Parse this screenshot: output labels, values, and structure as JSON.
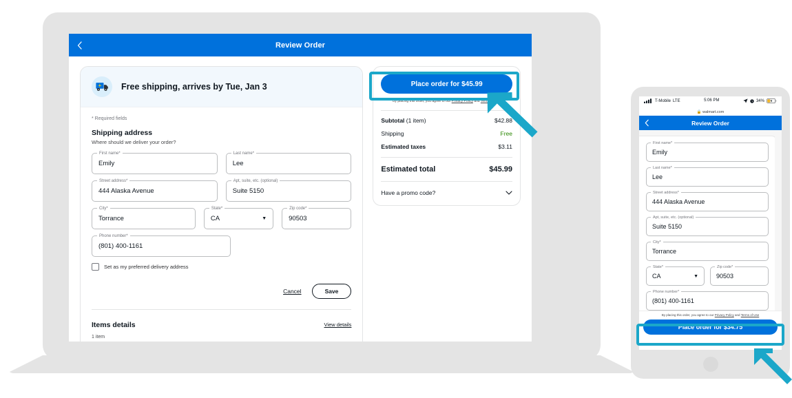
{
  "laptop": {
    "header": {
      "back_icon": "chevron-left-icon",
      "title": "Review Order"
    },
    "shipping_banner": {
      "icon": "delivery-truck-icon",
      "text": "Free shipping, arrives by Tue, Jan 3"
    },
    "required_note": "* Required fields",
    "section": {
      "title": "Shipping address",
      "subtitle": "Where should we deliver your order?"
    },
    "fields": [
      {
        "label": "First name*",
        "value": "Emily",
        "name": "first-name"
      },
      {
        "label": "Last name*",
        "value": "Lee",
        "name": "last-name"
      },
      {
        "label": "Street address*",
        "value": "444 Alaska Avenue",
        "name": "street-address"
      },
      {
        "label": "Apt, suite, etc. (optional)",
        "value": "Suite 5150",
        "name": "apt-suite"
      },
      {
        "label": "City*",
        "value": "Torrance",
        "name": "city"
      },
      {
        "label": "State*",
        "value": "CA",
        "name": "state"
      },
      {
        "label": "Zip code*",
        "value": "90503",
        "name": "zip-code"
      },
      {
        "label": "Phone number*",
        "value": "(801) 400-1161",
        "name": "phone-number"
      }
    ],
    "checkbox_label": "Set as my preferred delivery address",
    "cancel_label": "Cancel",
    "save_label": "Save",
    "items": {
      "title": "Items details",
      "view_details": "View details",
      "count": "1 item"
    },
    "summary": {
      "cta": "Place order for $45.99",
      "disclaimer_pre": "By placing this order, you agree to our ",
      "disclaimer_link1": "Privacy Policy",
      "disclaimer_mid": " and ",
      "disclaimer_link2": "Terms of Use",
      "rows": [
        {
          "label_bold": "Subtotal",
          "label_rest": " (1 item)",
          "value": "$42.88",
          "free": false
        },
        {
          "label_bold": "",
          "label_rest": "Shipping",
          "value": "Free",
          "free": true
        },
        {
          "label_bold": "Estimated taxes",
          "label_rest": "",
          "value": "$3.11",
          "free": false
        }
      ],
      "total_label": "Estimated total",
      "total_value": "$45.99",
      "promo_label": "Have a promo code?",
      "promo_icon": "chevron-down-icon"
    }
  },
  "phone": {
    "status": {
      "carrier": "T-Mobile",
      "network": "LTE",
      "time": "5:06 PM",
      "battery": "34%"
    },
    "url": "walmart.com",
    "header": {
      "back_icon": "chevron-left-icon",
      "title": "Review Order"
    },
    "fields": [
      {
        "label": "First name*",
        "value": "Emily",
        "name": "first-name"
      },
      {
        "label": "Last name*",
        "value": "Lee",
        "name": "last-name"
      },
      {
        "label": "Street address*",
        "value": "444 Alaska Avenue",
        "name": "street-address"
      },
      {
        "label": "Apt, suite, etc. (optional)",
        "value": "Suite 5150",
        "name": "apt-suite"
      },
      {
        "label": "City*",
        "value": "Torrance",
        "name": "city"
      },
      {
        "label": "State*",
        "value": "CA",
        "name": "state"
      },
      {
        "label": "Zip code*",
        "value": "90503",
        "name": "zip-code"
      },
      {
        "label": "Phone number*",
        "value": "(801) 400-1161",
        "name": "phone-number"
      }
    ],
    "disclaimer_pre": "By placing this order, you agree to our ",
    "disclaimer_link1": "Privacy Policy",
    "disclaimer_mid": " and ",
    "disclaimer_link2": "Terms of Use",
    "cta": "Place order for $34.75"
  },
  "colors": {
    "brand_blue": "#0071dc",
    "highlight_teal": "#1ba7c9",
    "free_green": "#2a8703",
    "device_gray": "#e4e4e4"
  }
}
